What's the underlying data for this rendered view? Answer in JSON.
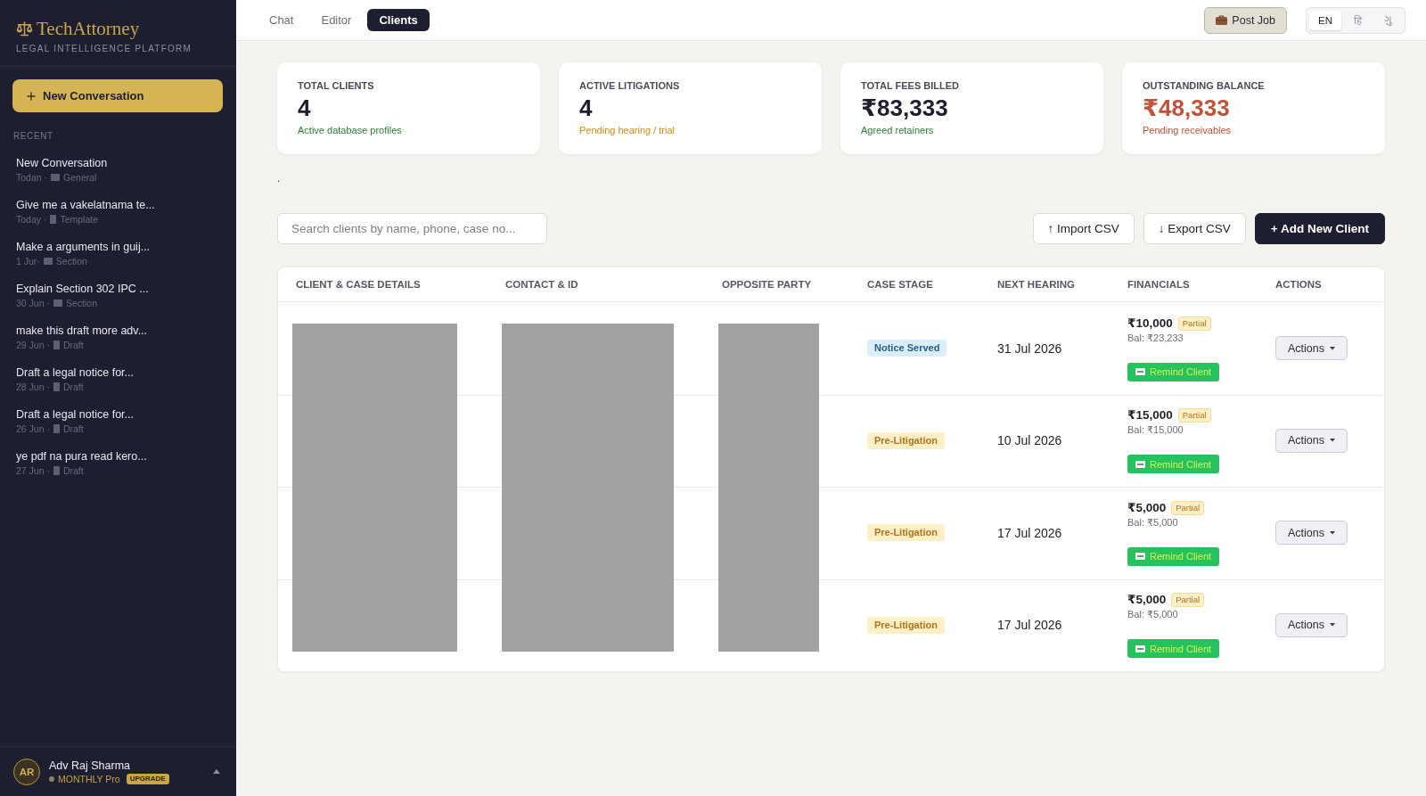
{
  "sidebar": {
    "brand": {
      "name": "TechAttorney",
      "tagline": "LEGAL INTELLIGENCE PLATFORM"
    },
    "new_button": {
      "label": "New Conversation"
    },
    "section_label": "RECENT",
    "items": [
      {
        "title": "New Conversation",
        "date": "Todan ·",
        "kind": "topic",
        "category": "General",
        "selected": false
      },
      {
        "title": "Give me a vakelatnama te...",
        "date": "Today ·",
        "kind": "document",
        "category": "Template",
        "selected": false
      },
      {
        "title": "Make a arguments in guij...",
        "date": "1 Jur·",
        "kind": "topic",
        "category": "Section",
        "selected": false
      },
      {
        "title": "Explain Section 302 IPC ...",
        "date": "30 Jun ·",
        "kind": "topic",
        "category": "Section",
        "selected": false
      },
      {
        "title": "make this draft more adv...",
        "date": "29 Jun ·",
        "kind": "document",
        "category": "Draft",
        "selected": false
      },
      {
        "title": "Draft a legal notice for...",
        "date": "28 Jun ·",
        "kind": "document",
        "category": "Draft",
        "selected": false
      },
      {
        "title": "Draft a legal notice for...",
        "date": "26 Jun ·",
        "kind": "document",
        "category": "Draft",
        "selected": false
      },
      {
        "title": "ye pdf na pura read kero...",
        "date": "27 Jun ·",
        "kind": "document",
        "category": "Draft",
        "selected": false
      }
    ],
    "user": {
      "initials": "AR",
      "name": "Adv Raj Sharma",
      "plan": "MONTHLY Pro",
      "badge": "UPGRADE"
    }
  },
  "tabs": [
    {
      "label": "Chat",
      "selected": false
    },
    {
      "label": "Editor",
      "selected": false
    },
    {
      "label": "Clients",
      "selected": true
    }
  ],
  "header_actions": {
    "post_job": "Post Job",
    "languages": [
      {
        "label": "EN",
        "selected": true
      },
      {
        "label": "हि",
        "selected": false
      },
      {
        "label": "ગુ",
        "selected": false
      }
    ]
  },
  "stats": [
    {
      "label": "TOTAL CLIENTS",
      "value": "4",
      "caption": "Active database profiles",
      "color": "#2e7d3a",
      "highlight": false
    },
    {
      "label": "ACTIVE LITIGATIONS",
      "value": "4",
      "caption": "Pending hearing / trial",
      "color": "#d08a17",
      "highlight": false
    },
    {
      "label": "TOTAL FEES BILLED",
      "value": "₹83,333",
      "caption": "Agreed retainers",
      "color": "#2e7d3a",
      "highlight": false
    },
    {
      "label": "OUTSTANDING BALANCE",
      "value": "₹48,333",
      "caption": "Pending receivables",
      "color": "#c0533a",
      "highlight": true
    }
  ],
  "note": ".",
  "search": {
    "placeholder": "Search clients by name, phone, case no..."
  },
  "toolbar_buttons": [
    {
      "label": "↑ Import CSV",
      "kind": "outline"
    },
    {
      "label": "↓ Export CSV",
      "kind": "outline"
    },
    {
      "label": "+ Add New Client",
      "kind": "primary"
    }
  ],
  "table": {
    "columns": [
      {
        "label": "CLIENT & CASE DETAILS",
        "redacted": true
      },
      {
        "label": "CONTACT & ID",
        "redacted": true
      },
      {
        "label": "OPPOSITE PARTY",
        "redacted": true
      },
      {
        "label": "CASE STAGE",
        "redacted": false
      },
      {
        "label": "NEXT HEARING",
        "redacted": false
      },
      {
        "label": "FINANCIALS",
        "redacted": false
      },
      {
        "label": "ACTIONS",
        "redacted": false
      }
    ],
    "rows": [
      {
        "stage": {
          "label": "Notice Served",
          "kind": "info"
        },
        "next_hearing": "31 Jul 2026",
        "fee": "₹10,000",
        "fee_status": "Partial",
        "balance": "Bal: ₹23,233",
        "remind": "Remind Client",
        "action": "Actions"
      },
      {
        "stage": {
          "label": "Pre-Litigation",
          "kind": "warning"
        },
        "next_hearing": "10 Jul 2026",
        "fee": "₹15,000",
        "fee_status": "Partial",
        "balance": "Bal: ₹15,000",
        "remind": "Remind Client",
        "action": "Actions"
      },
      {
        "stage": {
          "label": "Pre-Litigation",
          "kind": "warning"
        },
        "next_hearing": "17 Jul 2026",
        "fee": "₹5,000",
        "fee_status": "Partial",
        "balance": "Bal: ₹5,000",
        "remind": "Remind Client",
        "action": "Actions"
      },
      {
        "stage": {
          "label": "Pre-Litigation",
          "kind": "warning"
        },
        "next_hearing": "17 Jul 2026",
        "fee": "₹5,000",
        "fee_status": "Partial",
        "balance": "Bal: ₹5,000",
        "remind": "Remind Client",
        "action": "Actions"
      }
    ]
  }
}
